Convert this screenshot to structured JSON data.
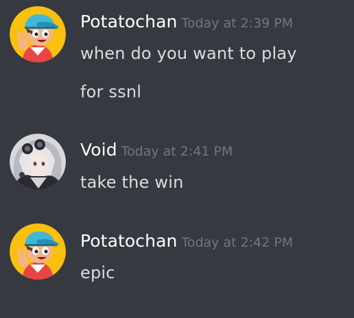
{
  "messages": [
    {
      "username": "Potatochan",
      "timestamp": "Today at 2:39 PM",
      "avatar_icon": "cartoon-boy-cap-avatar-icon",
      "lines": [
        "when do you want to play",
        "for ssnl"
      ]
    },
    {
      "username": "Void",
      "timestamp": "Today at 2:41 PM",
      "avatar_icon": "anime-girl-avatar-icon",
      "lines": [
        "take the win"
      ]
    },
    {
      "username": "Potatochan",
      "timestamp": "Today at 2:42 PM",
      "avatar_icon": "cartoon-boy-cap-avatar-icon",
      "lines": [
        "epic"
      ]
    }
  ],
  "colors": {
    "background": "#36393f",
    "username": "#ffffff",
    "timestamp": "#72767d",
    "message_text": "#dcddde",
    "potato_avatar_bg": "#f9c00e"
  }
}
